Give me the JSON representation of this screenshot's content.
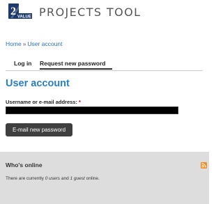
{
  "header": {
    "logo_icon": "value-logo",
    "logo_letter": "2",
    "logo_text": "VALUE",
    "site_name": "PROJECTS TOOL"
  },
  "breadcrumb": {
    "home": "Home",
    "separator": "»",
    "current": "User account"
  },
  "tabs": [
    {
      "label": "Log in",
      "active": false
    },
    {
      "label": "Request new password",
      "active": true
    }
  ],
  "page": {
    "title": "User account"
  },
  "form": {
    "field_label": "Username or e-mail address:",
    "required_marker": "*",
    "field_value": "",
    "submit_label": "E-mail new password"
  },
  "whos_online": {
    "title": "Who's online",
    "text_prefix": "There are currently ",
    "users": "0 users",
    "text_middle": " and ",
    "guests": "1 guest",
    "text_suffix": " online.",
    "feed_icon": "rss-feed-icon"
  },
  "colors": {
    "link": "#2a72b5",
    "title": "#2a7fc4",
    "button": "#3f3f3f",
    "block_bg": "#dddddd",
    "rss": "#f48a1b"
  }
}
